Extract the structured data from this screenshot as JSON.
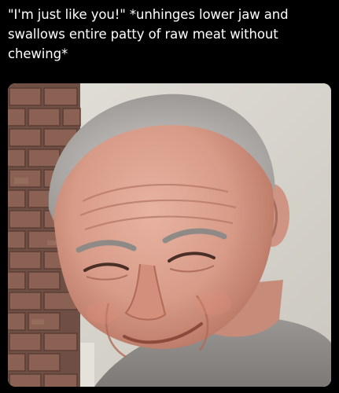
{
  "post": {
    "caption": "\"I'm just like you!\" *unhinges lower jaw and swallows entire patty of raw meat without chewing*"
  },
  "photo": {
    "subject": "smiling-older-man-photo",
    "colors": {
      "wall": "#dad7cf",
      "brick": "#7f5a4d",
      "skin": "#d9a08e",
      "hair": "#b9b6b3",
      "shirt": "#8f8b88"
    }
  }
}
